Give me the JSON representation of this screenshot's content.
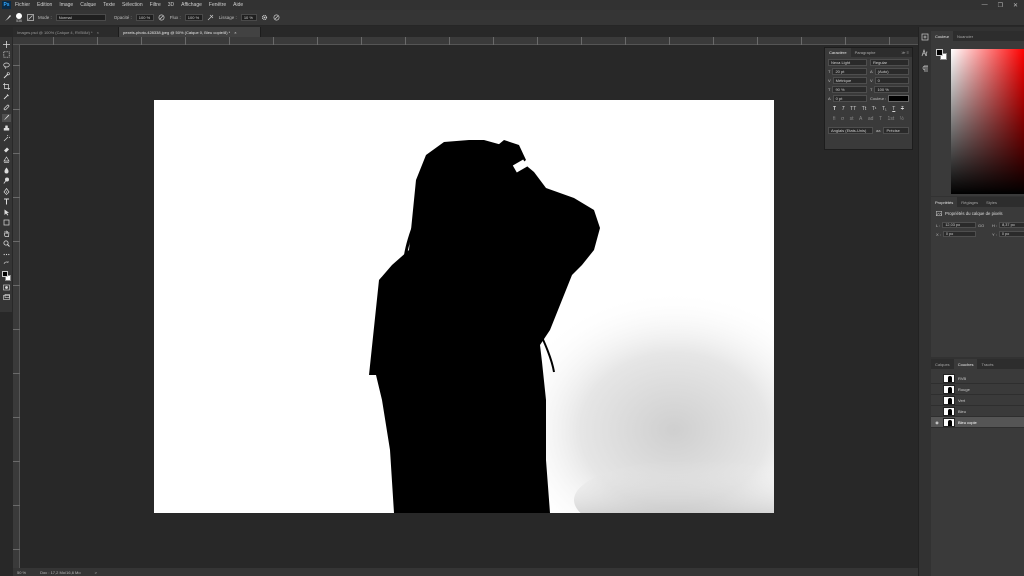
{
  "menubar": {
    "logo": "Ps",
    "items": [
      "Fichier",
      "Edition",
      "Image",
      "Calque",
      "Texte",
      "Sélection",
      "Filtre",
      "3D",
      "Affichage",
      "Fenêtre",
      "Aide"
    ],
    "win_minimize": "—",
    "win_maximize": "❐",
    "win_close": "✕"
  },
  "options": {
    "brush_size": "536",
    "mode_label": "Mode :",
    "mode_value": "Normal",
    "opacity_label": "Opacité :",
    "opacity_value": "100 %",
    "flow_label": "Flux :",
    "flow_value": "100 %",
    "smoothing_label": "Lissage :",
    "smoothing_value": "10 %"
  },
  "tabs": [
    {
      "label": "Images.psd @ 100% (Calque 4, RVB/8#) *",
      "close": "×"
    },
    {
      "label": "pexels-photo-428338.jpeg @ 50% (Calque 0, Bleu copie/8) *",
      "close": "×"
    }
  ],
  "status": {
    "zoom": "50 %",
    "doc": "Doc : 17,2 Mo/16,6 Mo",
    "arrow": ">"
  },
  "character_panel": {
    "tabs": [
      "Caractère",
      "Paragraphe"
    ],
    "tab_icons": "≫ ≡",
    "font_family": "Nexa Light",
    "font_style": "Regular",
    "font_size": "20 pt",
    "leading": "(Auto)",
    "kerning": "Métrique",
    "tracking": "0",
    "vscale": "90 %",
    "hscale": "100 %",
    "baseline": "0 pt",
    "color_label": "Couleur :",
    "glyphs_row1": [
      "T",
      "T",
      "TT",
      "Tt",
      "T¹",
      "T₁",
      "T",
      "T"
    ],
    "glyphs_row2": [
      "fi",
      "σ",
      "st",
      "A",
      "ad",
      "T",
      "1st",
      "½"
    ],
    "language": "Anglais (Etats-Unis)",
    "aa_icon": "aa",
    "antialias": "Précise"
  },
  "dock": {
    "color_tabs": [
      "Couleur",
      "Nuancier"
    ],
    "props_tabs": [
      "Propriétés",
      "Réglages",
      "Styles"
    ],
    "props_title": "Propriétés du calque de pixels",
    "props": {
      "w_label": "L :",
      "w_value": "12,03 po",
      "link": "GO",
      "h_label": "H :",
      "h_value": "8,37 po",
      "x_label": "X :",
      "x_value": "0 po",
      "y_label": "Y :",
      "y_value": "0 po"
    },
    "layers_tabs": [
      "Calques",
      "Couches",
      "Tracés"
    ],
    "channels": [
      "RVB",
      "Rouge",
      "Vert",
      "Bleu",
      "Bleu copie"
    ],
    "active_channel_eye": "◉"
  },
  "colors": {
    "accent": "#31a8ff",
    "panel": "#3a3a3a",
    "canvas_bg": "#282828"
  },
  "icons": {
    "tools": [
      "move-icon",
      "marquee-icon",
      "lasso-icon",
      "quick-select-icon",
      "crop-icon",
      "eyedropper-icon",
      "healing-icon",
      "brush-icon",
      "stamp-icon",
      "history-brush-icon",
      "eraser-icon",
      "gradient-icon",
      "blur-icon",
      "dodge-icon",
      "pen-icon",
      "type-icon",
      "path-select-icon",
      "shape-icon",
      "hand-icon",
      "zoom-icon",
      "more-icon"
    ]
  }
}
